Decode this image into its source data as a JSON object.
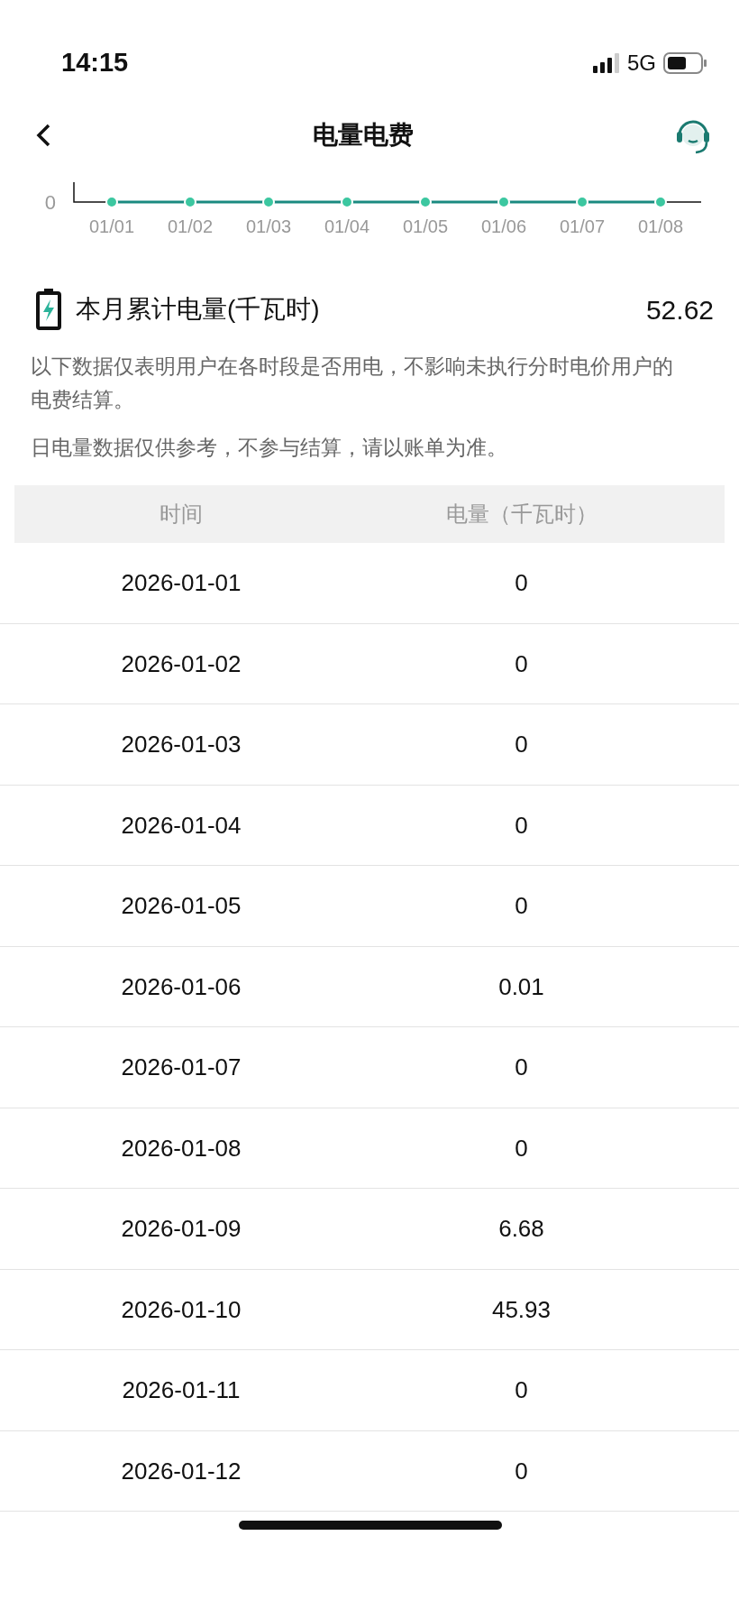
{
  "status_bar": {
    "time": "14:15",
    "network": "5G"
  },
  "header": {
    "title": "电量电费"
  },
  "chart": {
    "y_label": "0",
    "x_labels": [
      "01/01",
      "01/02",
      "01/03",
      "01/04",
      "01/05",
      "01/06",
      "01/07",
      "01/08"
    ]
  },
  "summary": {
    "label": "本月累计电量(千瓦时)",
    "value": "52.62"
  },
  "notes": [
    "以下数据仅表明用户在各时段是否用电，不影响未执行分时电价用户的电费结算。",
    "日电量数据仅供参考，不参与结算，请以账单为准。"
  ],
  "table": {
    "columns": [
      "时间",
      "电量（千瓦时）"
    ],
    "rows": [
      [
        "2026-01-01",
        "0"
      ],
      [
        "2026-01-02",
        "0"
      ],
      [
        "2026-01-03",
        "0"
      ],
      [
        "2026-01-04",
        "0"
      ],
      [
        "2026-01-05",
        "0"
      ],
      [
        "2026-01-06",
        "0.01"
      ],
      [
        "2026-01-07",
        "0"
      ],
      [
        "2026-01-08",
        "0"
      ],
      [
        "2026-01-09",
        "6.68"
      ],
      [
        "2026-01-10",
        "45.93"
      ],
      [
        "2026-01-11",
        "0"
      ],
      [
        "2026-01-12",
        "0"
      ]
    ]
  }
}
